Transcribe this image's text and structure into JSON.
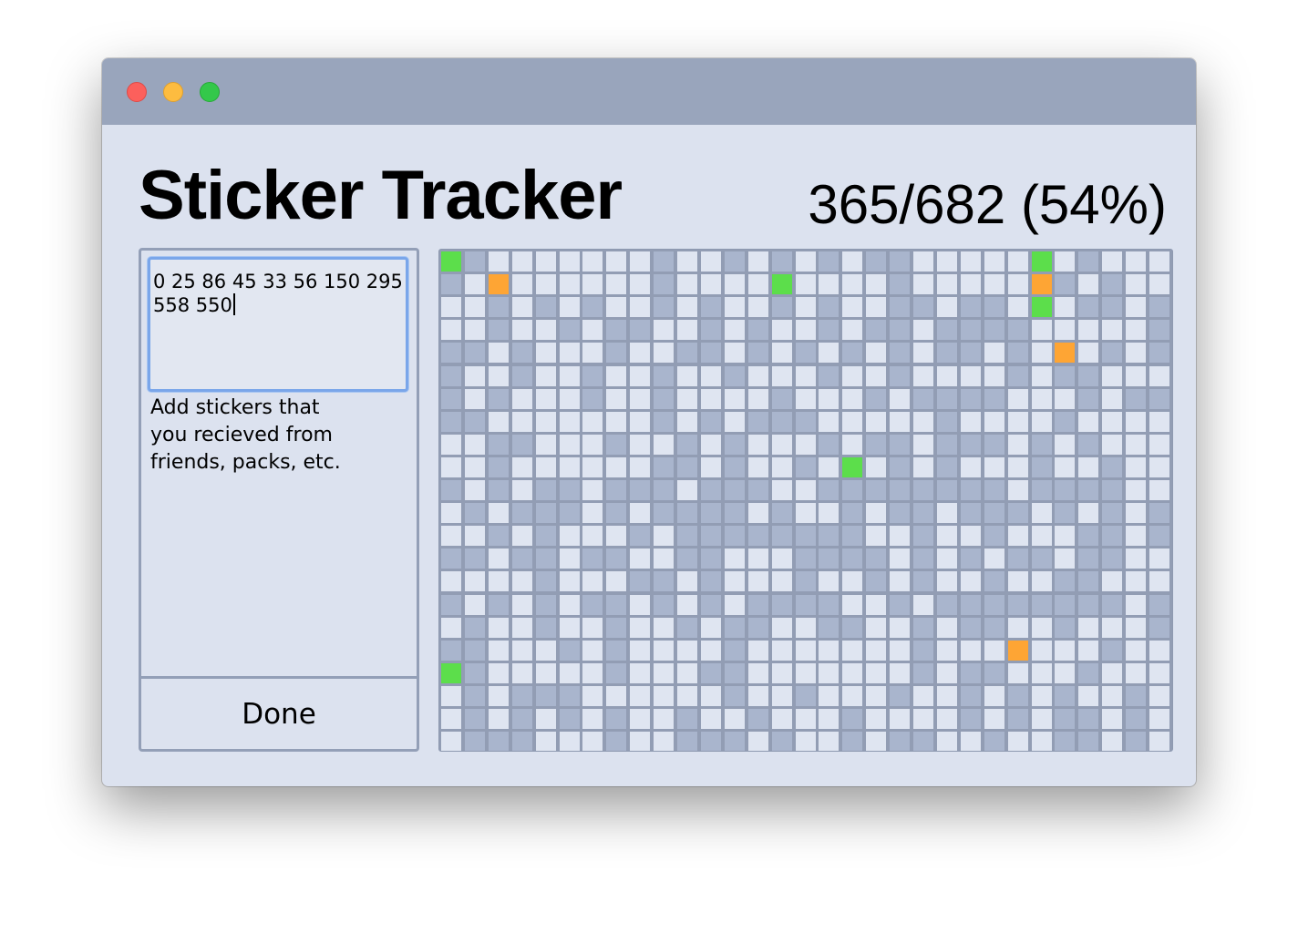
{
  "window": {
    "controls": [
      "close-icon",
      "minimize-icon",
      "zoom-icon"
    ],
    "colors": {
      "background": "#dce2ef",
      "titlebar": "#99a5bc"
    }
  },
  "header": {
    "title": "Sticker Tracker",
    "progress": "365/682 (54%)"
  },
  "input": {
    "value": "0 25 86 45 33 56 150 295\n558 550",
    "hint": "Add stickers that\nyou recieved from\nfriends, packs, etc."
  },
  "done_label": "Done",
  "sticker_grid": {
    "columns": 31,
    "rows": 22,
    "colors": {
      "have": "#dfe5f1",
      "need": "#a9b5cd",
      "new": "#5cde4b",
      "duplicate": "#fea534"
    },
    "cells": [
      "g.n.l.l.l.l.l.l.l.n.l.l.n.l.n.l.n.l.n.n.l.l.l.l.l.g.l.n.l.l.l",
      "n.l.o.l.l.l.l.l.l.n.l.l.l.l.g.l.l.l.l.n.l.l.l.l.l.o.n.l.n.l.l",
      "l.l.n.l.n.l.n.l.l.n.l.n.l.l.n.l.n.l.l.n.n.l.n.n.l.g.l.n.n.l.n",
      "l.l.n.l.l.n.l.n.n.l.l.n.l.n.l.l.n.l.n.n.l.n.n.n.n.l.l.l.l.l.n",
      "n.n.l.n.l.l.l.n.l.l.n.n.l.n.l.n.l.n.l.n.l.n.n.l.n.l.o.l.n.l.n",
      "n.l.l.n.l.l.n.l.l.n.l.l.n.l.l.l.n.l.l.n.l.l.l.l.n.l.n.n.l.l.l",
      "n.l.n.l.l.l.n.l.l.n.l.l.l.l.n.l.l.l.n.l.n.n.n.n.l.l.l.n.l.n.n",
      "n.n.l.l.l.l.l.l.l.n.l.n.l.n.n.n.l.l.l.l.l.n.l.l.l.l.n.l.l.l.l",
      "l.l.n.n.l.l.l.n.l.l.n.l.n.l.l.l.n.l.n.n.l.n.n.n.l.n.l.n.l.l.l",
      "l.l.n.l.l.l.l.l.l.n.n.l.n.l.l.n.l.g.l.n.l.n.l.l.l.n.l.l.n.l.l",
      "n.l.n.l.n.n.l.n.n.n.l.n.n.n.l.l.n.n.n.n.n.n.n.n.l.n.n.n.n.l.l",
      "l.n.l.n.n.n.l.n.l.n.n.n.n.l.n.l.l.n.l.n.n.l.n.n.n.l.n.l.n.l.n",
      "l.l.n.l.n.l.l.l.n.l.n.n.n.n.n.n.n.n.l.l.n.l.l.n.l.l.l.n.n.l.n",
      "n.n.l.n.n.l.n.n.l.l.n.n.l.l.l.n.n.n.n.l.n.l.n.l.n.n.l.n.n.l.l",
      "l.l.l.l.n.l.l.l.n.n.l.n.l.l.l.n.l.l.n.l.n.l.l.n.l.l.n.n.l.l.l",
      "n.l.n.l.n.l.n.n.l.n.l.n.l.n.n.n.n.l.l.n.l.n.n.n.n.n.n.n.n.l.n",
      "l.n.l.l.n.l.l.n.l.l.n.l.n.n.l.l.n.n.l.l.n.l.n.n.l.l.n.l.l.l.n",
      "n.n.l.l.l.n.l.n.l.l.l.l.n.l.l.l.l.l.l.l.n.l.l.l.o.l.l.l.n.l.l",
      "g.n.l.l.l.l.l.n.l.l.l.n.n.l.l.l.l.l.l.l.n.l.n.n.l.l.l.n.l.l.l",
      "l.n.l.n.n.n.l.l.l.l.l.l.n.l.l.n.l.l.l.n.l.l.n.l.n.l.n.l.l.n.l",
      "l.n.l.n.l.n.l.n.l.l.n.l.l.n.l.l.l.n.l.l.l.l.n.l.n.l.n.n.l.n.l",
      "l.n.n.n.l.l.l.n.l.l.n.n.n.l.n.l.l.n.l.n.n.l.l.n.l.l.n.n.l.n.l"
    ]
  }
}
